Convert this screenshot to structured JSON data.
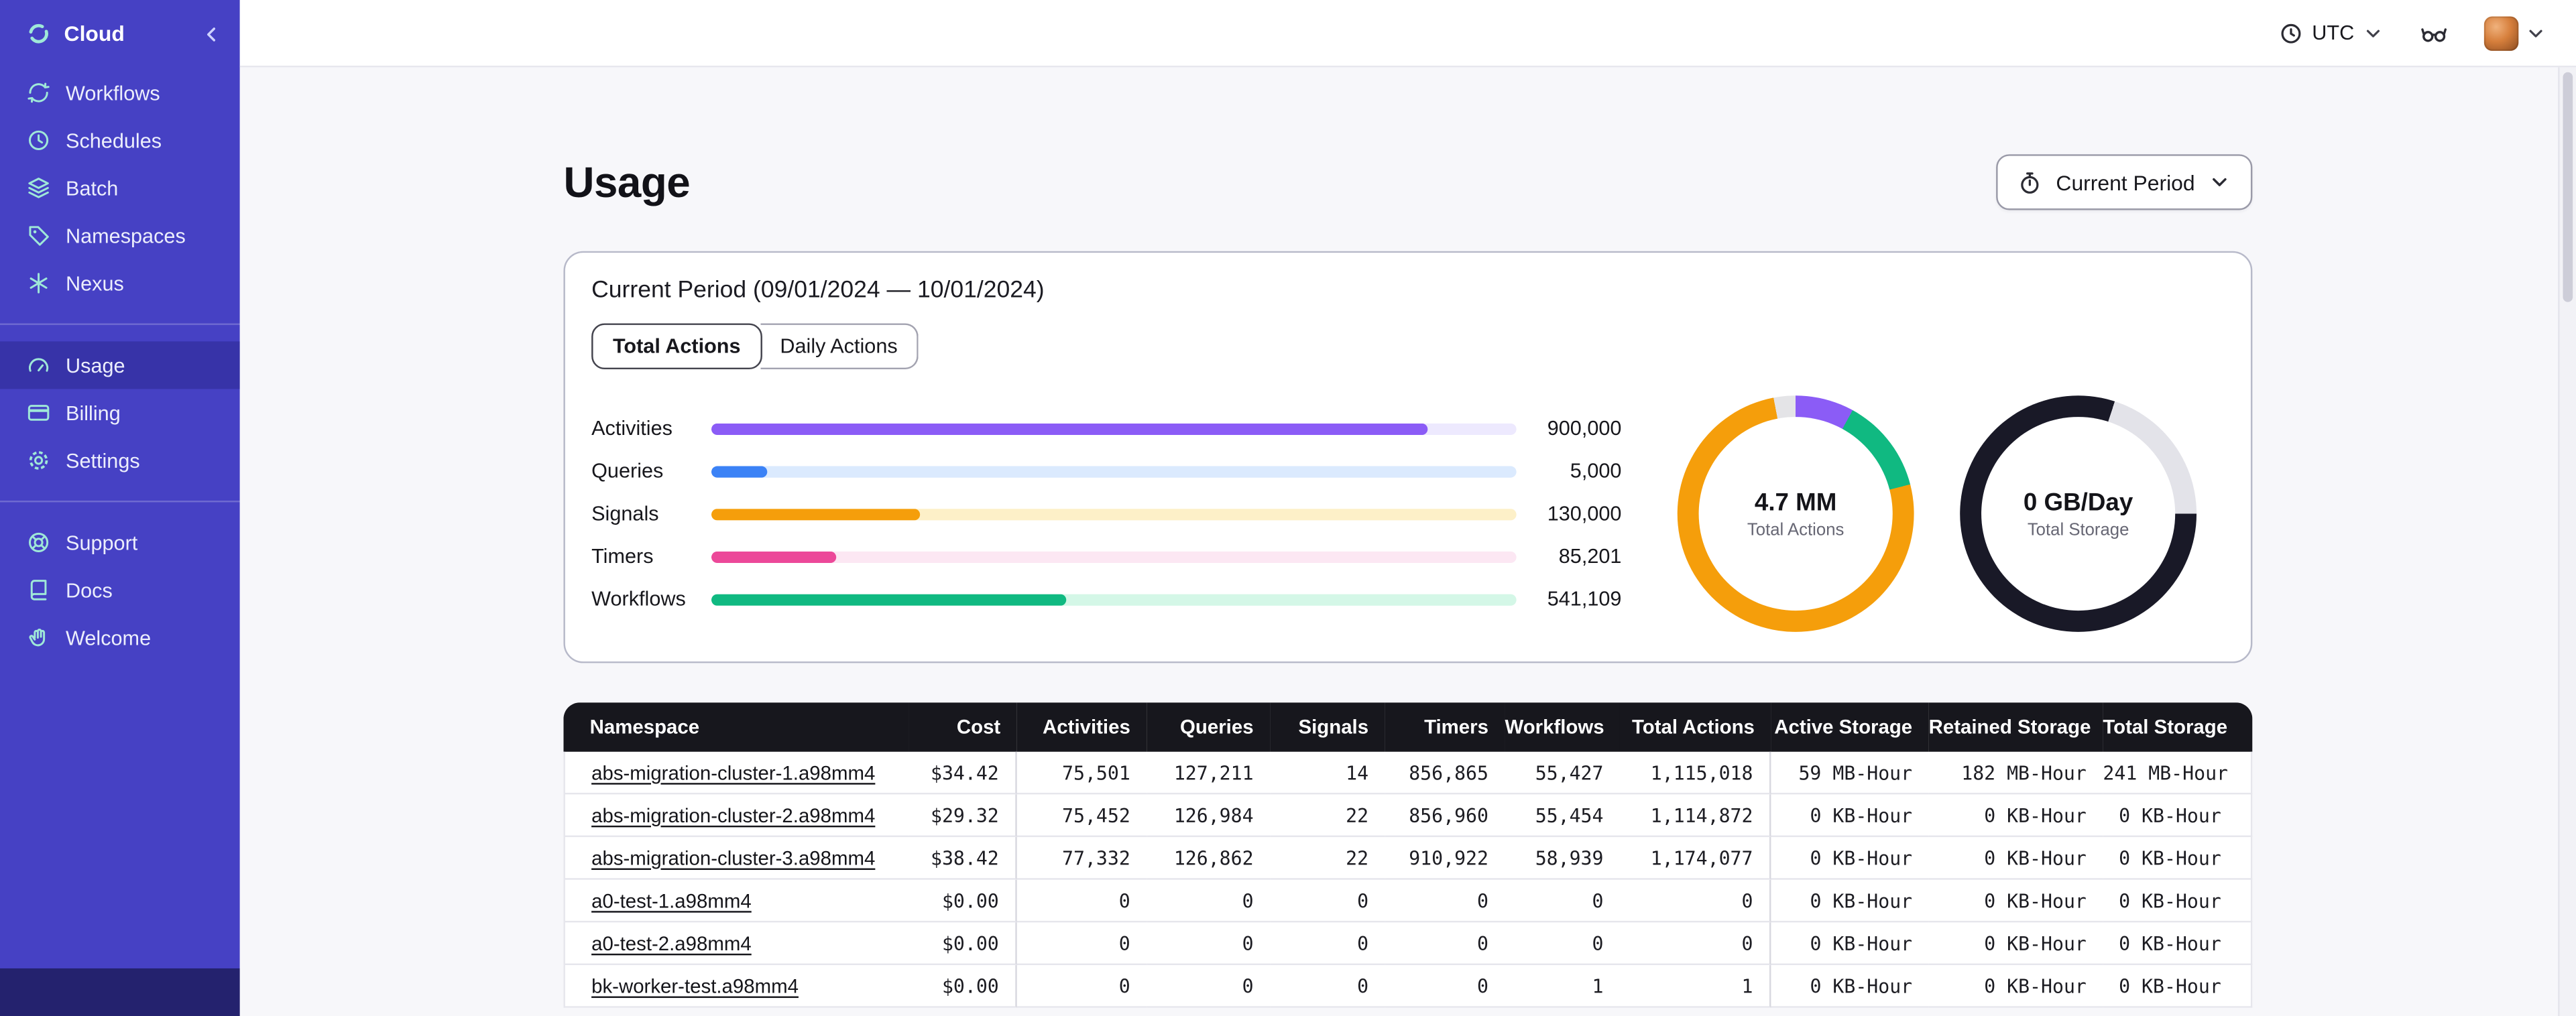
{
  "sidebar": {
    "brand": {
      "label": "Cloud"
    },
    "groups": [
      {
        "name": "primary",
        "items": [
          {
            "label": "Workflows",
            "icon": "workflows"
          },
          {
            "label": "Schedules",
            "icon": "schedules"
          },
          {
            "label": "Batch",
            "icon": "batch"
          },
          {
            "label": "Namespaces",
            "icon": "namespaces"
          },
          {
            "label": "Nexus",
            "icon": "nexus"
          }
        ]
      },
      {
        "name": "account",
        "items": [
          {
            "label": "Usage",
            "icon": "usage",
            "active": true
          },
          {
            "label": "Billing",
            "icon": "billing"
          },
          {
            "label": "Settings",
            "icon": "settings"
          }
        ]
      },
      {
        "name": "help",
        "items": [
          {
            "label": "Support",
            "icon": "support"
          },
          {
            "label": "Docs",
            "icon": "docs"
          },
          {
            "label": "Welcome",
            "icon": "welcome"
          }
        ]
      }
    ]
  },
  "topbar": {
    "timezone": "UTC"
  },
  "page": {
    "title": "Usage",
    "period_button": "Current Period"
  },
  "usage_card": {
    "title": "Current Period (09/01/2024 — 10/01/2024)",
    "tabs": [
      {
        "label": "Total Actions",
        "active": true
      },
      {
        "label": "Daily Actions",
        "active": false
      }
    ]
  },
  "chart_data": [
    {
      "type": "bar",
      "title": "Total Actions by type",
      "orientation": "horizontal",
      "categories": [
        "Activities",
        "Queries",
        "Signals",
        "Timers",
        "Workflows"
      ],
      "values": [
        900000,
        5000,
        130000,
        85201,
        541109
      ],
      "value_labels": [
        "900,000",
        "5,000",
        "130,000",
        "85,201",
        "541,109"
      ],
      "bar_fill_pct": [
        89,
        7,
        26,
        15.5,
        44
      ],
      "bar_colors": [
        {
          "fill": "#8b5cf6",
          "track": "#ede9fe"
        },
        {
          "fill": "#3b82f6",
          "track": "#dbeafe"
        },
        {
          "fill": "#f59e0b",
          "track": "#fdf0c8"
        },
        {
          "fill": "#ec4899",
          "track": "#fce7f3"
        },
        {
          "fill": "#10b981",
          "track": "#d4f7e7"
        }
      ]
    },
    {
      "type": "pie",
      "center_value": "4.7 MM",
      "center_label": "Total Actions",
      "segments": [
        {
          "name": "activities",
          "color": "#8b5cf6",
          "pct": 8
        },
        {
          "name": "workflows",
          "color": "#10b981",
          "pct": 13
        },
        {
          "name": "timers-signals",
          "color": "#f59e0b",
          "pct": 76
        },
        {
          "name": "other",
          "color": "#e4e4e7",
          "pct": 3
        }
      ]
    },
    {
      "type": "pie",
      "center_value": "0 GB/Day",
      "center_label": "Total Storage",
      "segments": [
        {
          "name": "storage-dark",
          "color": "#191927",
          "pct": 5
        },
        {
          "name": "storage-light",
          "color": "#e3e3e9",
          "pct": 20
        },
        {
          "name": "storage-dark-tail",
          "color": "#191927",
          "pct": 75
        }
      ]
    }
  ],
  "table": {
    "headers": [
      "Namespace",
      "Cost",
      "Activities",
      "Queries",
      "Signals",
      "Timers",
      "Workflows",
      "Total Actions",
      "Active Storage",
      "Retained Storage",
      "Total Storage"
    ],
    "rows": [
      [
        "abs-migration-cluster-1.a98mm4",
        "$34.42",
        "75,501",
        "127,211",
        "14",
        "856,865",
        "55,427",
        "1,115,018",
        "59 MB-Hour",
        "182 MB-Hour",
        "241 MB-Hour"
      ],
      [
        "abs-migration-cluster-2.a98mm4",
        "$29.32",
        "75,452",
        "126,984",
        "22",
        "856,960",
        "55,454",
        "1,114,872",
        "0 KB-Hour",
        "0 KB-Hour",
        "0 KB-Hour"
      ],
      [
        "abs-migration-cluster-3.a98mm4",
        "$38.42",
        "77,332",
        "126,862",
        "22",
        "910,922",
        "58,939",
        "1,174,077",
        "0 KB-Hour",
        "0 KB-Hour",
        "0 KB-Hour"
      ],
      [
        "a0-test-1.a98mm4",
        "$0.00",
        "0",
        "0",
        "0",
        "0",
        "0",
        "0",
        "0 KB-Hour",
        "0 KB-Hour",
        "0 KB-Hour"
      ],
      [
        "a0-test-2.a98mm4",
        "$0.00",
        "0",
        "0",
        "0",
        "0",
        "0",
        "0",
        "0 KB-Hour",
        "0 KB-Hour",
        "0 KB-Hour"
      ],
      [
        "bk-worker-test.a98mm4",
        "$0.00",
        "0",
        "0",
        "0",
        "0",
        "1",
        "1",
        "0 KB-Hour",
        "0 KB-Hour",
        "0 KB-Hour"
      ]
    ]
  }
}
